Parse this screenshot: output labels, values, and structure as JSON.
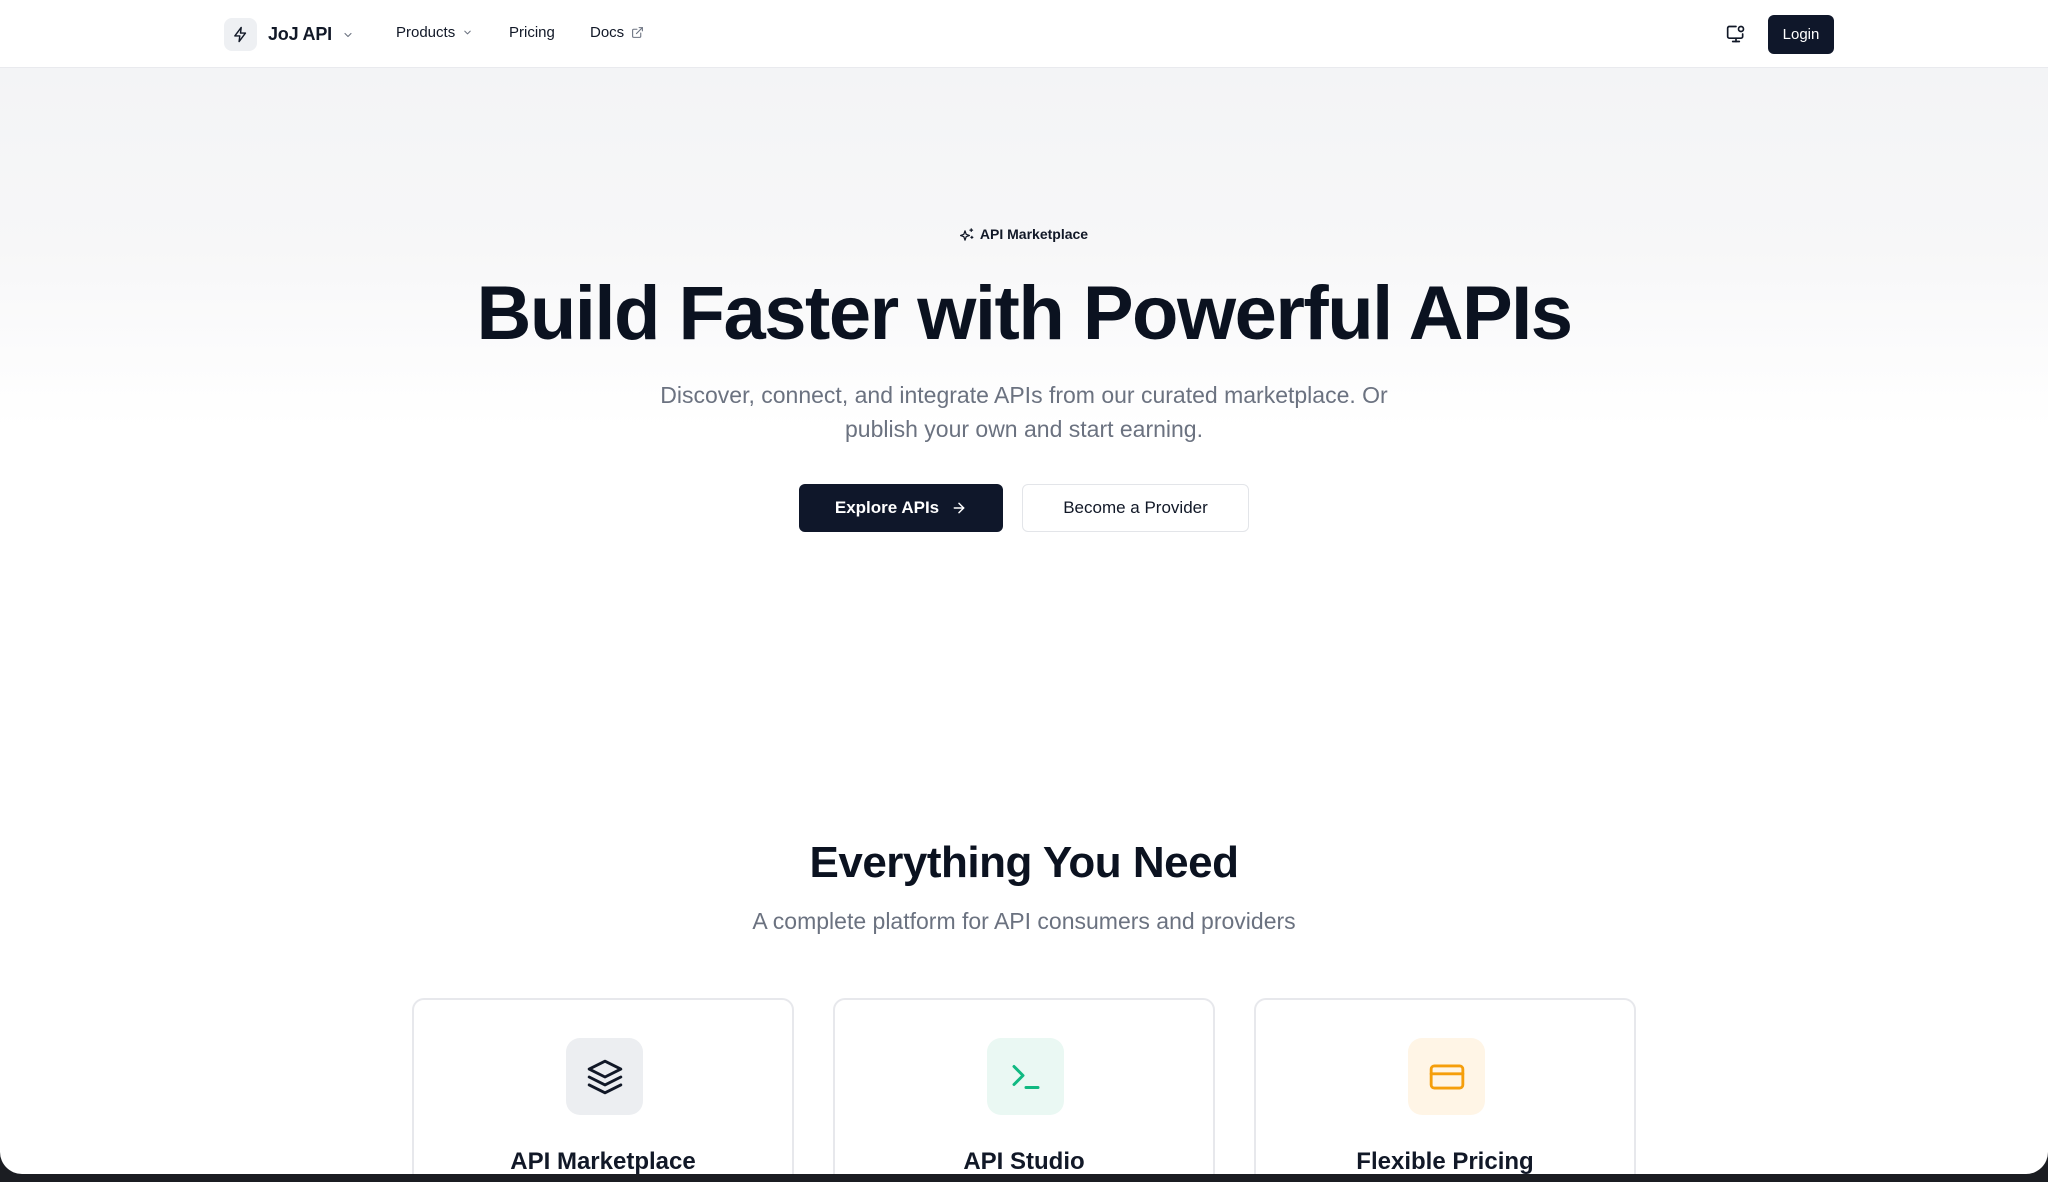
{
  "nav": {
    "brand": "JoJ API",
    "links": {
      "products": "Products",
      "pricing": "Pricing",
      "docs": "Docs"
    },
    "login": "Login"
  },
  "hero": {
    "eyebrow": "API Marketplace",
    "title": "Build Faster with Powerful APIs",
    "subtitle": "Discover, connect, and integrate APIs from our curated marketplace. Or publish your own and start earning.",
    "primary_cta": "Explore APIs",
    "secondary_cta": "Become a Provider"
  },
  "features": {
    "title": "Everything You Need",
    "subtitle": "A complete platform for API consumers and providers",
    "cards": [
      {
        "title": "API Marketplace",
        "icon": "layers-icon",
        "accent": "#111827"
      },
      {
        "title": "API Studio",
        "icon": "terminal-icon",
        "accent": "#10b981"
      },
      {
        "title": "Flexible Pricing",
        "icon": "credit-card-icon",
        "accent": "#f59e0b"
      }
    ]
  },
  "colors": {
    "primary": "#0f172a",
    "muted_text": "#6b7280"
  }
}
